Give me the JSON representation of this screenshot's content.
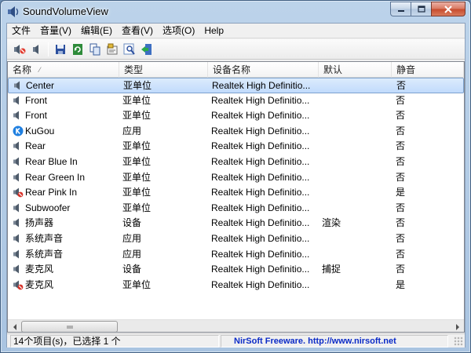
{
  "window": {
    "title": "SoundVolumeView"
  },
  "menu": [
    "文件",
    "音量(V)",
    "编辑(E)",
    "查看(V)",
    "选项(O)",
    "Help"
  ],
  "toolbar": {
    "buttons": [
      {
        "name": "mute-icon"
      },
      {
        "name": "unmute-icon"
      },
      {
        "name": "save-icon"
      },
      {
        "name": "refresh-icon"
      },
      {
        "name": "copy-icon"
      },
      {
        "name": "properties-icon"
      },
      {
        "name": "find-icon"
      },
      {
        "name": "exit-icon"
      }
    ]
  },
  "columns": [
    "名称",
    "类型",
    "设备名称",
    "默认",
    "静音"
  ],
  "rows": [
    {
      "name": "Center",
      "type": "亚单位",
      "device": "Realtek High Definitio...",
      "default": "",
      "muted": "否",
      "icon": "speaker",
      "selected": true
    },
    {
      "name": "Front",
      "type": "亚单位",
      "device": "Realtek High Definitio...",
      "default": "",
      "muted": "否",
      "icon": "speaker"
    },
    {
      "name": "Front",
      "type": "亚单位",
      "device": "Realtek High Definitio...",
      "default": "",
      "muted": "否",
      "icon": "speaker"
    },
    {
      "name": "KuGou",
      "type": "应用",
      "device": "Realtek High Definitio...",
      "default": "",
      "muted": "否",
      "icon": "app"
    },
    {
      "name": "Rear",
      "type": "亚单位",
      "device": "Realtek High Definitio...",
      "default": "",
      "muted": "否",
      "icon": "speaker"
    },
    {
      "name": "Rear Blue In",
      "type": "亚单位",
      "device": "Realtek High Definitio...",
      "default": "",
      "muted": "否",
      "icon": "speaker"
    },
    {
      "name": "Rear Green In",
      "type": "亚单位",
      "device": "Realtek High Definitio...",
      "default": "",
      "muted": "否",
      "icon": "speaker"
    },
    {
      "name": "Rear Pink In",
      "type": "亚单位",
      "device": "Realtek High Definitio...",
      "default": "",
      "muted": "是",
      "icon": "speaker-muted"
    },
    {
      "name": "Subwoofer",
      "type": "亚单位",
      "device": "Realtek High Definitio...",
      "default": "",
      "muted": "否",
      "icon": "speaker"
    },
    {
      "name": "扬声器",
      "type": "设备",
      "device": "Realtek High Definitio...",
      "default": "渲染",
      "muted": "否",
      "icon": "speaker"
    },
    {
      "name": "系统声音",
      "type": "应用",
      "device": "Realtek High Definitio...",
      "default": "",
      "muted": "否",
      "icon": "speaker"
    },
    {
      "name": "系统声音",
      "type": "应用",
      "device": "Realtek High Definitio...",
      "default": "",
      "muted": "否",
      "icon": "speaker"
    },
    {
      "name": "麦克风",
      "type": "设备",
      "device": "Realtek High Definitio...",
      "default": "捕捉",
      "muted": "否",
      "icon": "speaker"
    },
    {
      "name": "麦克风",
      "type": "亚单位",
      "device": "Realtek High Definitio...",
      "default": "",
      "muted": "是",
      "icon": "speaker-muted"
    }
  ],
  "status": {
    "count": "14个项目(s)，已选择 1 个",
    "link": "NirSoft Freeware.  http://www.nirsoft.net"
  }
}
